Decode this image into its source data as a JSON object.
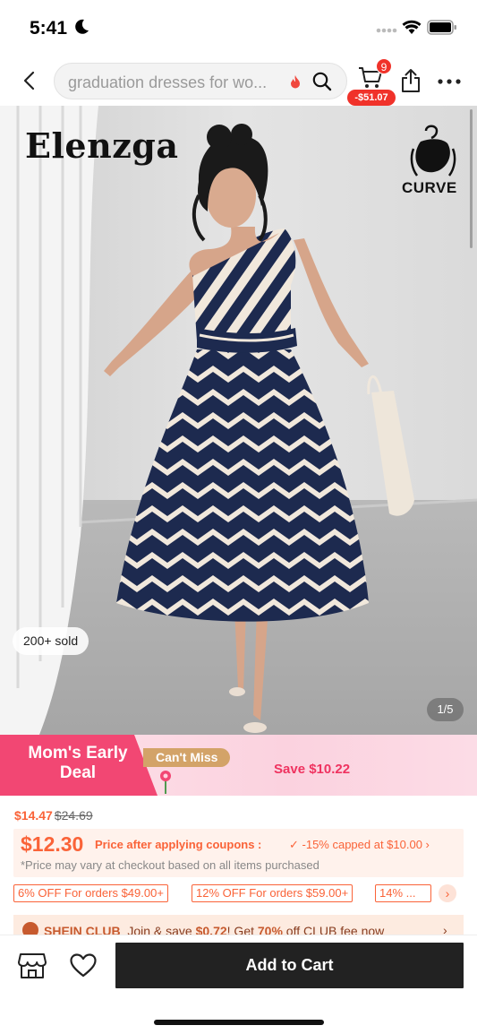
{
  "status_bar": {
    "time": "5:41"
  },
  "search": {
    "query": "graduation dresses for wo..."
  },
  "cart": {
    "badge_count": "9",
    "discount_pill": "-$51.07"
  },
  "hero": {
    "brand": "Elenzga",
    "curve_label": "CURVE",
    "sold_badge": "200+ sold",
    "image_counter": "1/5",
    "colors": {
      "navy": "#1d2a4f",
      "cream": "#f1e8dc",
      "wall": "#dedede"
    }
  },
  "promo": {
    "title": "Mom's Early Deal",
    "cant_miss": "Can't Miss",
    "save_text": "Save $10.22"
  },
  "price": {
    "current": "$14.47",
    "original": "$24.69",
    "coupon_price": "$12.30",
    "coupon_label": "Price after applying coupons :",
    "coupon_cap": "✓ -15% capped at $10.00 ›",
    "note": "*Price may vary at checkout based on all items purchased"
  },
  "offers": [
    {
      "label": "6% OFF For orders $49.00+"
    },
    {
      "label": "12% OFF For orders $59.00+"
    },
    {
      "label": "14% ..."
    }
  ],
  "club": {
    "name": "SHEIN CLUB",
    "pre": "Join & save ",
    "save_amount": "$0.72",
    "mid": "! Get ",
    "percent": "70%",
    "post": " off CLUB fee now"
  },
  "bottom_bar": {
    "add_to_cart": "Add to Cart"
  },
  "accent_colors": {
    "orange": "#fa6338",
    "pink": "#f24773",
    "gold": "#d3a368"
  }
}
